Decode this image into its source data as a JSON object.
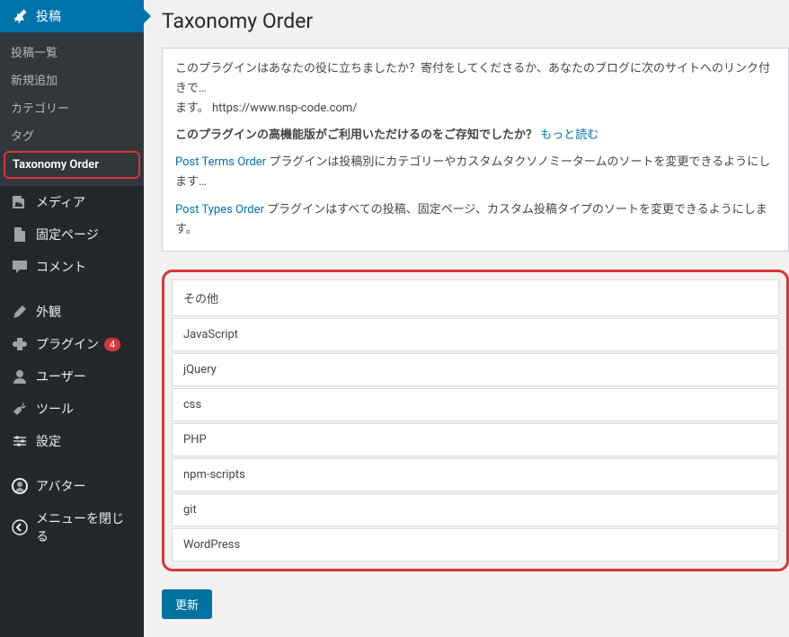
{
  "sidebar": {
    "activeItem": {
      "label": "投稿"
    },
    "submenu": {
      "items": [
        {
          "label": "投稿一覧"
        },
        {
          "label": "新規追加"
        },
        {
          "label": "カテゴリー"
        },
        {
          "label": "タグ"
        },
        {
          "label": "Taxonomy Order"
        }
      ]
    },
    "mainItems": [
      {
        "label": "メディア",
        "icon": "media"
      },
      {
        "label": "固定ページ",
        "icon": "page"
      },
      {
        "label": "コメント",
        "icon": "comment"
      },
      {
        "label": "外観",
        "icon": "appearance"
      },
      {
        "label": "プラグイン",
        "icon": "plugin",
        "badge": "4"
      },
      {
        "label": "ユーザー",
        "icon": "user"
      },
      {
        "label": "ツール",
        "icon": "tool"
      },
      {
        "label": "設定",
        "icon": "settings"
      },
      {
        "label": "アバター",
        "icon": "avatar"
      },
      {
        "label": "メニューを閉じる",
        "icon": "collapse"
      }
    ]
  },
  "page": {
    "title": "Taxonomy Order",
    "infoBox": {
      "donation_text": "このプラグインはあなたの役に立ちましたか？寄付をしてくださるか、あなたのブログに次のサイトへのリンク付きで…",
      "donation_prefix": "ます。",
      "donation_url": "https://www.nsp-code.com/",
      "premium_text_prefix": "このプラグインの高機能版がご利用いただけるのをご存知でしたか？",
      "premium_link": "もっと読む",
      "post_terms_link": "Post Terms Order",
      "post_terms_text": " プラグインは投稿別にカテゴリーやカスタムタクソノミータームのソートを変更できるようにします…",
      "post_types_link": "Post Types Order",
      "post_types_text": " プラグインはすべての投稿、固定ページ、カスタム投稿タイプのソートを変更できるようにします。"
    },
    "sortableItems": [
      "その他",
      "JavaScript",
      "jQuery",
      "css",
      "PHP",
      "npm-scripts",
      "git",
      "WordPress"
    ],
    "updateButton": "更新"
  }
}
